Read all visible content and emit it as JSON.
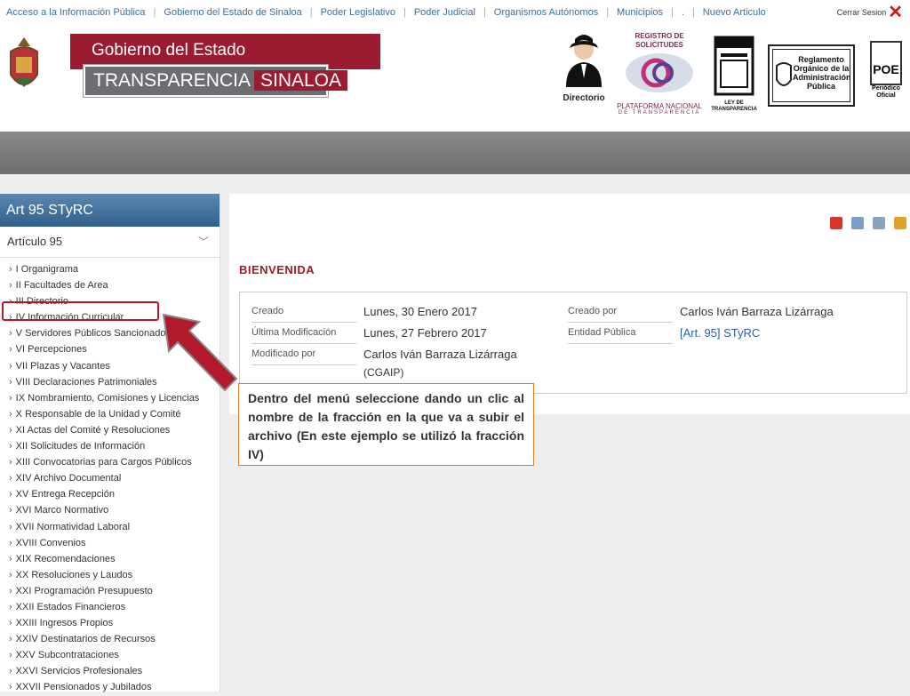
{
  "topnav": {
    "links": [
      "Acceso a la Información Pública",
      "Gobierno del Estado de Sinaloa",
      "Poder Legislativo",
      "Poder Judicial",
      "Organismos Autónomos",
      "Municipios",
      ".",
      "Nuevo Articulo"
    ],
    "logout": "Cerrar Sesion"
  },
  "header": {
    "banner_line1": "Gobierno del Estado",
    "banner_transparencia": "TRANSPARENCIA",
    "banner_sinaloa": "SINALOA",
    "directorio": "Directorio",
    "registro": "REGISTRO DE SOLICITUDES",
    "plataforma": "PLATAFORMA NACIONAL",
    "plataforma_sub": "DE TRANSPARENCIA",
    "ley": "LEY DE TRANSPARENCIA",
    "reglamento": "Reglamento Orgánico de la Administración Pública",
    "poe": "POE",
    "poe_label": "Periódico Oficial"
  },
  "sidebar": {
    "title": "Art 95 STyRC",
    "section": "Artículo 95",
    "items": [
      "I Organigrama",
      "II Facultades de Area",
      "III Directorio",
      "IV Información Curricular",
      "V Servidores Públicos Sancionados",
      "VI Percepciones",
      "VII Plazas y Vacantes",
      "VIII Declaraciones Patrimoniales",
      "IX Nombramiento, Comisiones y Licencias",
      "X Responsable de la Unidad y Comité",
      "XI Actas del Comité y Resoluciones",
      "XII Solicitudes de Información",
      "XIII Convocatorias para Cargos Públicos",
      "XIV Archivo Documental",
      "XV Entrega Recepción",
      "XVI Marco Normativo",
      "XVII Normatividad Laboral",
      "XVIII Convenios",
      "XIX Recomendaciones",
      "XX Resoluciones y Laudos",
      "XXI Programación Presupuesto",
      "XXII Estados Financieros",
      "XXIII Ingresos Propios",
      "XXIV Destinatarios de Recursos",
      "XXV Subcontrataciones",
      "XXVI Servicios Profesionales",
      "XXVII Pensionados y Jubilados"
    ]
  },
  "main": {
    "welcome": "BIENVENIDA",
    "creado_label": "Creado",
    "creado_value": "Lunes, 30 Enero 2017",
    "modificacion_label": "Última Modificación",
    "modificacion_value": "Lunes, 27 Febrero 2017",
    "modificado_label": "Modificado por",
    "modificado_value": "Carlos Iván Barraza Lizárraga",
    "modificado_value2": "(CGAIP)",
    "creadopor_label": "Creado por",
    "creadopor_value": "Carlos Iván Barraza Lizárraga",
    "entidad_label": "Entidad Pública",
    "entidad_value": "[Art. 95] STyRC"
  },
  "callout": {
    "text": "Dentro del menú seleccione dando un clic al nombre de la fracción en la que va a subir el archivo (En este ejemplo se utilizó la fracción IV)"
  },
  "colors": {
    "brand_red": "#9b1b30",
    "banner_gray": "#6d6e71",
    "sidebar_blue": "#2f5f8c",
    "highlight": "#c01527"
  }
}
